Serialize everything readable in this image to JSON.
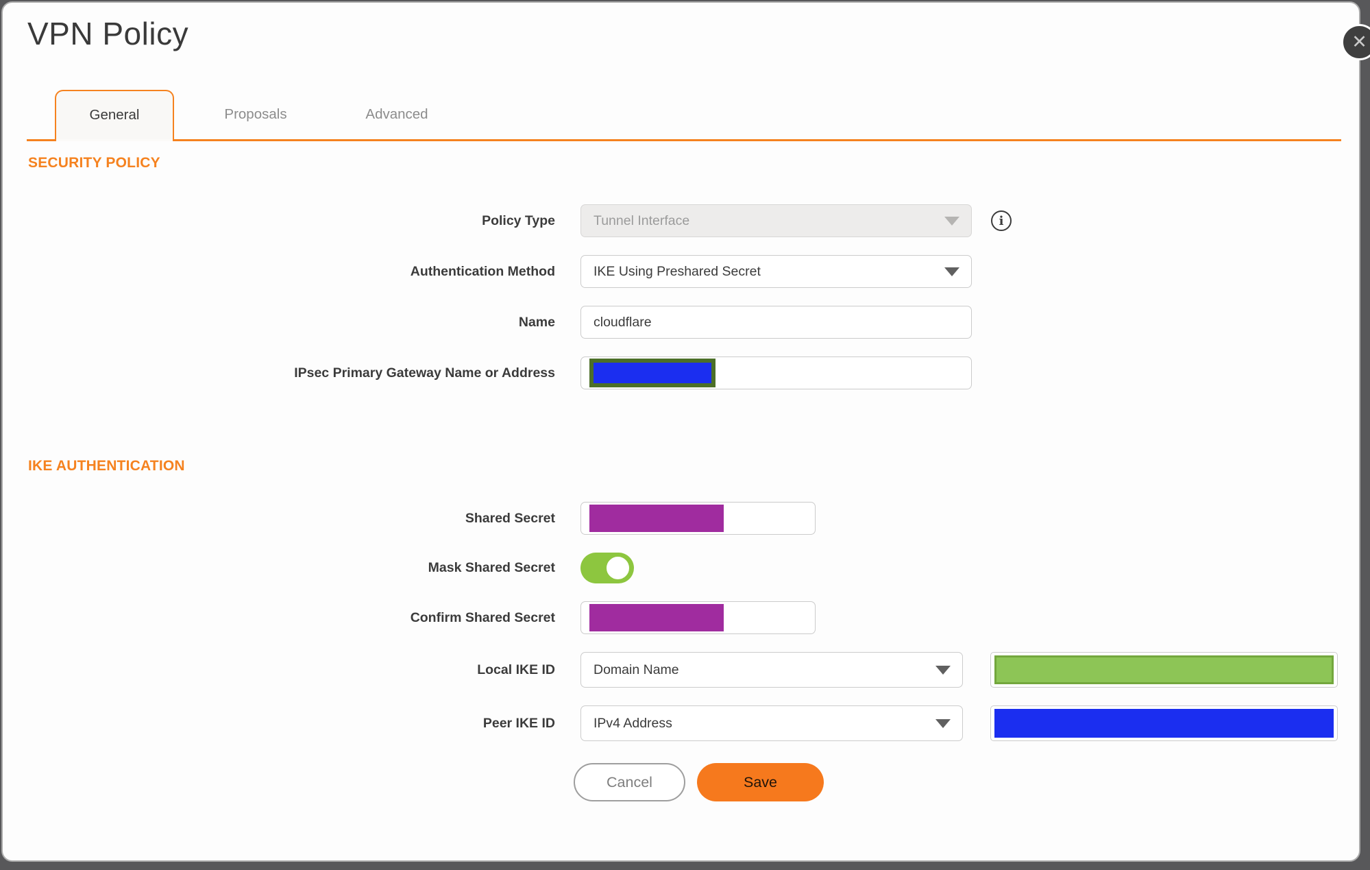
{
  "window": {
    "title": "VPN Policy",
    "close_icon": "✕"
  },
  "tabs": {
    "items": [
      {
        "label": "General",
        "active": true
      },
      {
        "label": "Proposals",
        "active": false
      },
      {
        "label": "Advanced",
        "active": false
      }
    ]
  },
  "security_policy": {
    "heading": "SECURITY POLICY",
    "policy_type": {
      "label": "Policy Type",
      "value": "Tunnel Interface",
      "disabled": true,
      "info_icon": "i"
    },
    "authentication_method": {
      "label": "Authentication Method",
      "value": "IKE Using Preshared Secret"
    },
    "name": {
      "label": "Name",
      "value": "cloudflare"
    },
    "gateway": {
      "label": "IPsec Primary Gateway Name or Address",
      "value_redacted": true,
      "redaction_color": "#1B2EF0",
      "redaction_border_color": "#4C6F28"
    }
  },
  "ike_authentication": {
    "heading": "IKE AUTHENTICATION",
    "shared_secret": {
      "label": "Shared Secret",
      "value_redacted": true,
      "redaction_color": "#A02C9F"
    },
    "mask_shared_secret": {
      "label": "Mask Shared Secret",
      "state": "on",
      "toggle_color": "#8DC63F"
    },
    "confirm_shared_secret": {
      "label": "Confirm Shared Secret",
      "value_redacted": true,
      "redaction_color": "#A02C9F"
    },
    "local_ike_id": {
      "label": "Local IKE ID",
      "value": "Domain Name",
      "value_redacted": true,
      "redaction_color": "#8DC556"
    },
    "peer_ike_id": {
      "label": "Peer IKE ID",
      "value": "IPv4 Address",
      "value_redacted": true,
      "redaction_color": "#1B2EF0"
    }
  },
  "actions": {
    "cancel": "Cancel",
    "save": "Save"
  },
  "colors": {
    "accent_orange": "#F5821F",
    "save_button_orange": "#F6791D",
    "toggle_green": "#8DC63F",
    "redact_purple": "#A02C9F",
    "redact_blue": "#1B2EF0",
    "redact_green": "#8DC556",
    "redact_olive_border": "#4C6F28",
    "background_gray": "#58585A"
  }
}
